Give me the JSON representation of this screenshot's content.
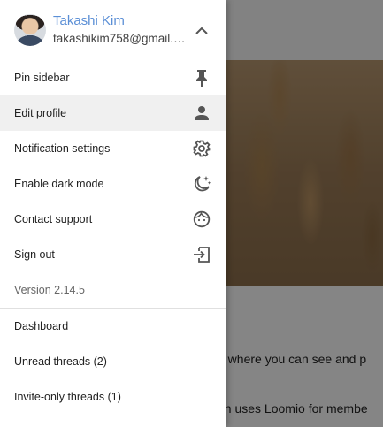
{
  "account": {
    "name": "Takashi Kim",
    "email": "takashikim758@gmail.c..."
  },
  "menu": [
    {
      "label": "Pin sidebar",
      "icon": "pin-icon"
    },
    {
      "label": "Edit profile",
      "icon": "person-icon"
    },
    {
      "label": "Notification settings",
      "icon": "gear-icon"
    },
    {
      "label": "Enable dark mode",
      "icon": "moon-icon"
    },
    {
      "label": "Contact support",
      "icon": "support-face-icon"
    },
    {
      "label": "Sign out",
      "icon": "sign-out-icon"
    }
  ],
  "version": "Version 2.14.5",
  "nav": [
    {
      "label": "Dashboard"
    },
    {
      "label": "Unread threads (2)"
    },
    {
      "label": "Invite-only threads (1)"
    }
  ],
  "background": {
    "line1": "p where you can see and p",
    "line2": "on uses Loomio for membe"
  },
  "colors": {
    "accent": "#5b8fd6",
    "active_row": "#f0f0f0",
    "icon": "#555555"
  }
}
